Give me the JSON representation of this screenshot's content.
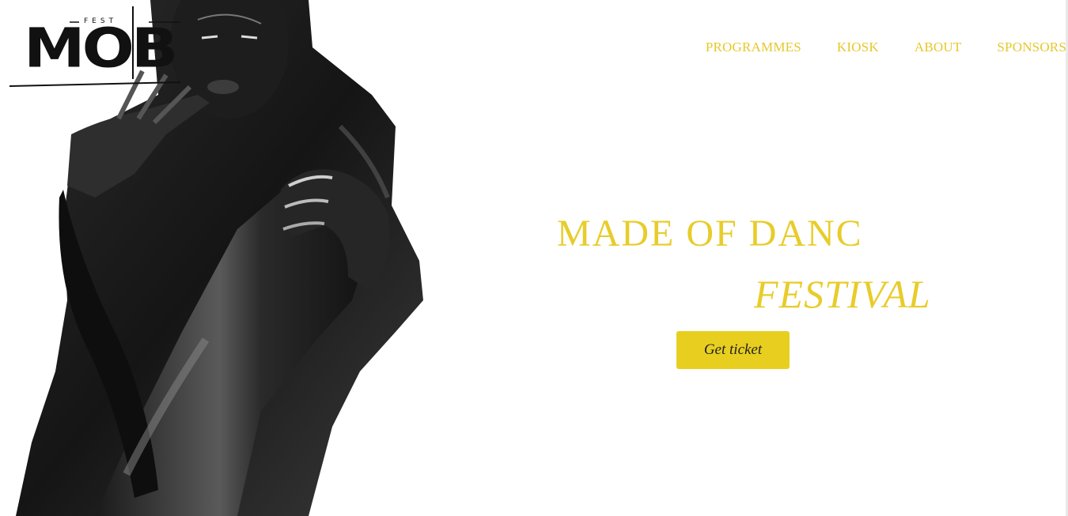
{
  "brand": {
    "logo_small_text": "FEST",
    "logo_word": "MOB"
  },
  "nav": {
    "items": [
      {
        "label": "PROGRAMMES"
      },
      {
        "label": "KIOSK"
      },
      {
        "label": "ABOUT"
      },
      {
        "label": "SPONSORS"
      }
    ]
  },
  "hero": {
    "headline": "MADE OF DANC",
    "subheadline": "FESTIVAL",
    "cta_label": "Get ticket",
    "image_subject": "black-and-white photo of a dancer"
  },
  "colors": {
    "accent": "#e8cc2a",
    "button": "#e8cf1f",
    "button_text": "#222222",
    "background": "#ffffff"
  }
}
